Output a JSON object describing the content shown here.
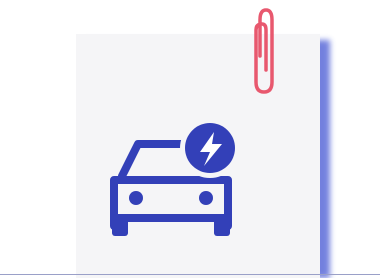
{
  "colors": {
    "card": "#f5f5f7",
    "shadow": "#5b6bd9",
    "icon_blue": "#3340b8",
    "clip_red": "#e8586e"
  },
  "icons": {
    "main": "electric-car-icon",
    "badge": "lightning-bolt-icon",
    "clip": "paperclip-icon"
  }
}
